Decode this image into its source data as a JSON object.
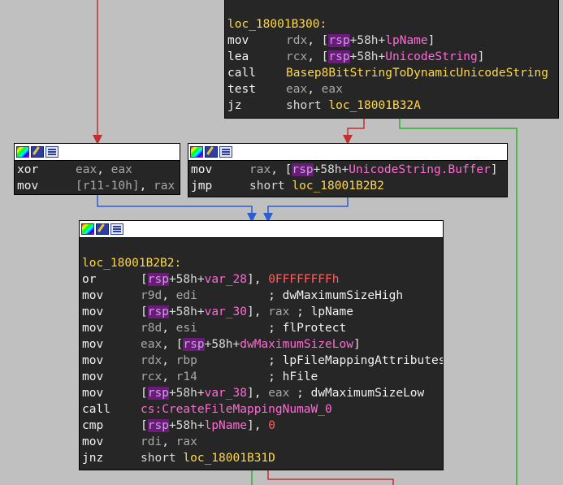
{
  "colors": {
    "background": "#c0c0c0",
    "node_bg": "#262626",
    "edge_true": "#2db22d",
    "edge_false": "#c03030",
    "edge_uncond": "#2a5fd0",
    "label": "#ffd84a",
    "symbol": "#ff6ad5"
  },
  "header_icons": [
    "color-palette-icon",
    "edit-pencil-icon",
    "graph-overview-icon"
  ],
  "nodes": {
    "top": {
      "lines": [
        [
          {
            "t": "loc_18001B300:",
            "c": "lbl"
          }
        ],
        [
          {
            "t": "mov",
            "c": "mn"
          },
          {
            "t": "rdx",
            "c": "reg"
          },
          {
            "t": ", [",
            "c": "plain"
          },
          {
            "t": "rsp",
            "c": "hl"
          },
          {
            "t": "+58h+",
            "c": "num"
          },
          {
            "t": "lpName",
            "c": "sym"
          },
          {
            "t": "]",
            "c": "plain"
          }
        ],
        [
          {
            "t": "lea",
            "c": "mn"
          },
          {
            "t": "rcx",
            "c": "reg"
          },
          {
            "t": ", [",
            "c": "plain"
          },
          {
            "t": "rsp",
            "c": "hl"
          },
          {
            "t": "+58h+",
            "c": "num"
          },
          {
            "t": "UnicodeString",
            "c": "sym"
          },
          {
            "t": "]",
            "c": "plain"
          }
        ],
        [
          {
            "t": "call",
            "c": "mn"
          },
          {
            "t": "Basep8BitStringToDynamicUnicodeString",
            "c": "fn"
          }
        ],
        [
          {
            "t": "test",
            "c": "mn"
          },
          {
            "t": "eax",
            "c": "reg"
          },
          {
            "t": ", ",
            "c": "plain"
          },
          {
            "t": "eax",
            "c": "reg"
          }
        ],
        [
          {
            "t": "jz",
            "c": "mn"
          },
          {
            "t": "short ",
            "c": "num"
          },
          {
            "t": "loc_18001B32A",
            "c": "fn"
          }
        ]
      ]
    },
    "left": {
      "lines": [
        [
          {
            "t": "xor",
            "c": "mn"
          },
          {
            "t": "eax",
            "c": "reg"
          },
          {
            "t": ", ",
            "c": "plain"
          },
          {
            "t": "eax",
            "c": "reg"
          }
        ],
        [
          {
            "t": "mov",
            "c": "mn"
          },
          {
            "t": "[r11-10h]",
            "c": "reg"
          },
          {
            "t": ", ",
            "c": "plain"
          },
          {
            "t": "rax",
            "c": "reg"
          }
        ]
      ]
    },
    "right": {
      "lines": [
        [
          {
            "t": "mov",
            "c": "mn"
          },
          {
            "t": "rax",
            "c": "reg"
          },
          {
            "t": ", [",
            "c": "plain"
          },
          {
            "t": "rsp",
            "c": "hl"
          },
          {
            "t": "+58h+",
            "c": "num"
          },
          {
            "t": "UnicodeString.Buffer",
            "c": "sym"
          },
          {
            "t": "]",
            "c": "plain"
          }
        ],
        [
          {
            "t": "jmp",
            "c": "mn"
          },
          {
            "t": "short ",
            "c": "num"
          },
          {
            "t": "loc_18001B2B2",
            "c": "fn"
          }
        ]
      ]
    },
    "main": {
      "lines": [
        [
          {
            "t": "",
            "c": "plain"
          }
        ],
        [
          {
            "t": "loc_18001B2B2:",
            "c": "lbl"
          }
        ],
        [
          {
            "t": "or",
            "c": "mn"
          },
          {
            "t": "[",
            "c": "plain"
          },
          {
            "t": "rsp",
            "c": "hl"
          },
          {
            "t": "+58h+",
            "c": "num"
          },
          {
            "t": "var_28",
            "c": "sym"
          },
          {
            "t": "], ",
            "c": "plain"
          },
          {
            "t": "0FFFFFFFFh",
            "c": "imm"
          }
        ],
        [
          {
            "t": "mov",
            "c": "mn"
          },
          {
            "t": "r9d",
            "c": "reg"
          },
          {
            "t": ", ",
            "c": "plain"
          },
          {
            "t": "edi",
            "c": "reg"
          },
          {
            "t": "          ; ",
            "c": "cmt"
          },
          {
            "t": "dwMaximumSizeHigh",
            "c": "cmt"
          }
        ],
        [
          {
            "t": "mov",
            "c": "mn"
          },
          {
            "t": "[",
            "c": "plain"
          },
          {
            "t": "rsp",
            "c": "hl"
          },
          {
            "t": "+58h+",
            "c": "num"
          },
          {
            "t": "var_30",
            "c": "sym"
          },
          {
            "t": "], ",
            "c": "plain"
          },
          {
            "t": "rax",
            "c": "reg"
          },
          {
            "t": " ; ",
            "c": "cmt"
          },
          {
            "t": "lpName",
            "c": "cmt"
          }
        ],
        [
          {
            "t": "mov",
            "c": "mn"
          },
          {
            "t": "r8d",
            "c": "reg"
          },
          {
            "t": ", ",
            "c": "plain"
          },
          {
            "t": "esi",
            "c": "reg"
          },
          {
            "t": "          ; ",
            "c": "cmt"
          },
          {
            "t": "flProtect",
            "c": "cmt"
          }
        ],
        [
          {
            "t": "mov",
            "c": "mn"
          },
          {
            "t": "eax",
            "c": "reg"
          },
          {
            "t": ", [",
            "c": "plain"
          },
          {
            "t": "rsp",
            "c": "hl"
          },
          {
            "t": "+58h+",
            "c": "num"
          },
          {
            "t": "dwMaximumSizeLow",
            "c": "sym"
          },
          {
            "t": "]",
            "c": "plain"
          }
        ],
        [
          {
            "t": "mov",
            "c": "mn"
          },
          {
            "t": "rdx",
            "c": "reg"
          },
          {
            "t": ", ",
            "c": "plain"
          },
          {
            "t": "rbp",
            "c": "reg"
          },
          {
            "t": "          ; ",
            "c": "cmt"
          },
          {
            "t": "lpFileMappingAttributes",
            "c": "cmt"
          }
        ],
        [
          {
            "t": "mov",
            "c": "mn"
          },
          {
            "t": "rcx",
            "c": "reg"
          },
          {
            "t": ", ",
            "c": "plain"
          },
          {
            "t": "r14",
            "c": "reg"
          },
          {
            "t": "          ; ",
            "c": "cmt"
          },
          {
            "t": "hFile",
            "c": "cmt"
          }
        ],
        [
          {
            "t": "mov",
            "c": "mn"
          },
          {
            "t": "[",
            "c": "plain"
          },
          {
            "t": "rsp",
            "c": "hl"
          },
          {
            "t": "+58h+",
            "c": "num"
          },
          {
            "t": "var_38",
            "c": "sym"
          },
          {
            "t": "], ",
            "c": "plain"
          },
          {
            "t": "eax",
            "c": "reg"
          },
          {
            "t": " ; ",
            "c": "cmt"
          },
          {
            "t": "dwMaximumSizeLow",
            "c": "cmt"
          }
        ],
        [
          {
            "t": "call",
            "c": "mn"
          },
          {
            "t": "cs:",
            "c": "sym"
          },
          {
            "t": "CreateFileMappingNumaW_0",
            "c": "sym"
          }
        ],
        [
          {
            "t": "cmp",
            "c": "mn"
          },
          {
            "t": "[",
            "c": "plain"
          },
          {
            "t": "rsp",
            "c": "hl"
          },
          {
            "t": "+58h+",
            "c": "num"
          },
          {
            "t": "lpName",
            "c": "sym"
          },
          {
            "t": "], ",
            "c": "plain"
          },
          {
            "t": "0",
            "c": "imm"
          }
        ],
        [
          {
            "t": "mov",
            "c": "mn"
          },
          {
            "t": "rdi",
            "c": "reg"
          },
          {
            "t": ", ",
            "c": "plain"
          },
          {
            "t": "rax",
            "c": "reg"
          }
        ],
        [
          {
            "t": "jnz",
            "c": "mn"
          },
          {
            "t": "short ",
            "c": "num"
          },
          {
            "t": "loc_18001B31D",
            "c": "fn"
          }
        ]
      ]
    }
  }
}
